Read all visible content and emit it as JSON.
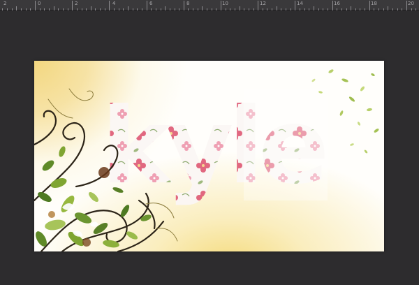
{
  "ruler": {
    "labels": [
      "2",
      "0",
      "2",
      "4",
      "6",
      "8",
      "10",
      "12",
      "14",
      "16",
      "18",
      "20"
    ]
  },
  "artboard": {
    "title_text": "kyle"
  },
  "colors": {
    "ui_background": "#2b2a2c",
    "ruler_background": "#3a393b",
    "artboard_base": "#fffefb",
    "gold_glow": "#f3d780",
    "flower_pink": "#d94a67",
    "vine_dark": "#2b2317",
    "leaf_green": "#7fa531"
  },
  "icons": [
    "leaf-icon",
    "flower-icon",
    "swirl-icon"
  ]
}
